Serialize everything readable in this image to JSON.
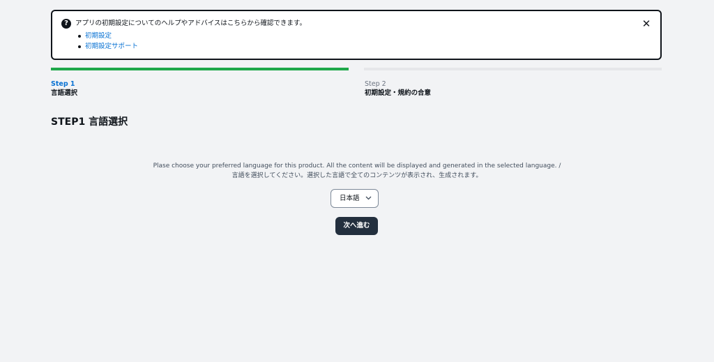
{
  "alert": {
    "help_icon": "?",
    "message": "アプリの初期設定についてのヘルプやアドバイスはこちらから確認できます。",
    "links": [
      "初期設定",
      "初期設定サポート"
    ],
    "close_icon": "✕"
  },
  "steps": [
    {
      "number": "Step 1",
      "name": "言語選択",
      "status": "active"
    },
    {
      "number": "Step 2",
      "name": "初期設定・規約の合意",
      "status": "inactive"
    }
  ],
  "main": {
    "heading": "STEP1 言語選択",
    "description_en": "Plase choose your preferred language for this product. All the content will be displayed and generated in the selected language. /",
    "description_ja": "言語を選択してください。選択した言語で全てのコンテンツが表示され、生成されます。",
    "language_select": {
      "value": "日本語",
      "icon": "chevron-down-icon"
    },
    "next_button": "次へ進む"
  },
  "colors": {
    "background": "#f2f3f5",
    "progress_active": "#1fa84a",
    "progress_inactive": "#e6e7ea",
    "link": "#0972d3",
    "button": "#232f3e"
  }
}
